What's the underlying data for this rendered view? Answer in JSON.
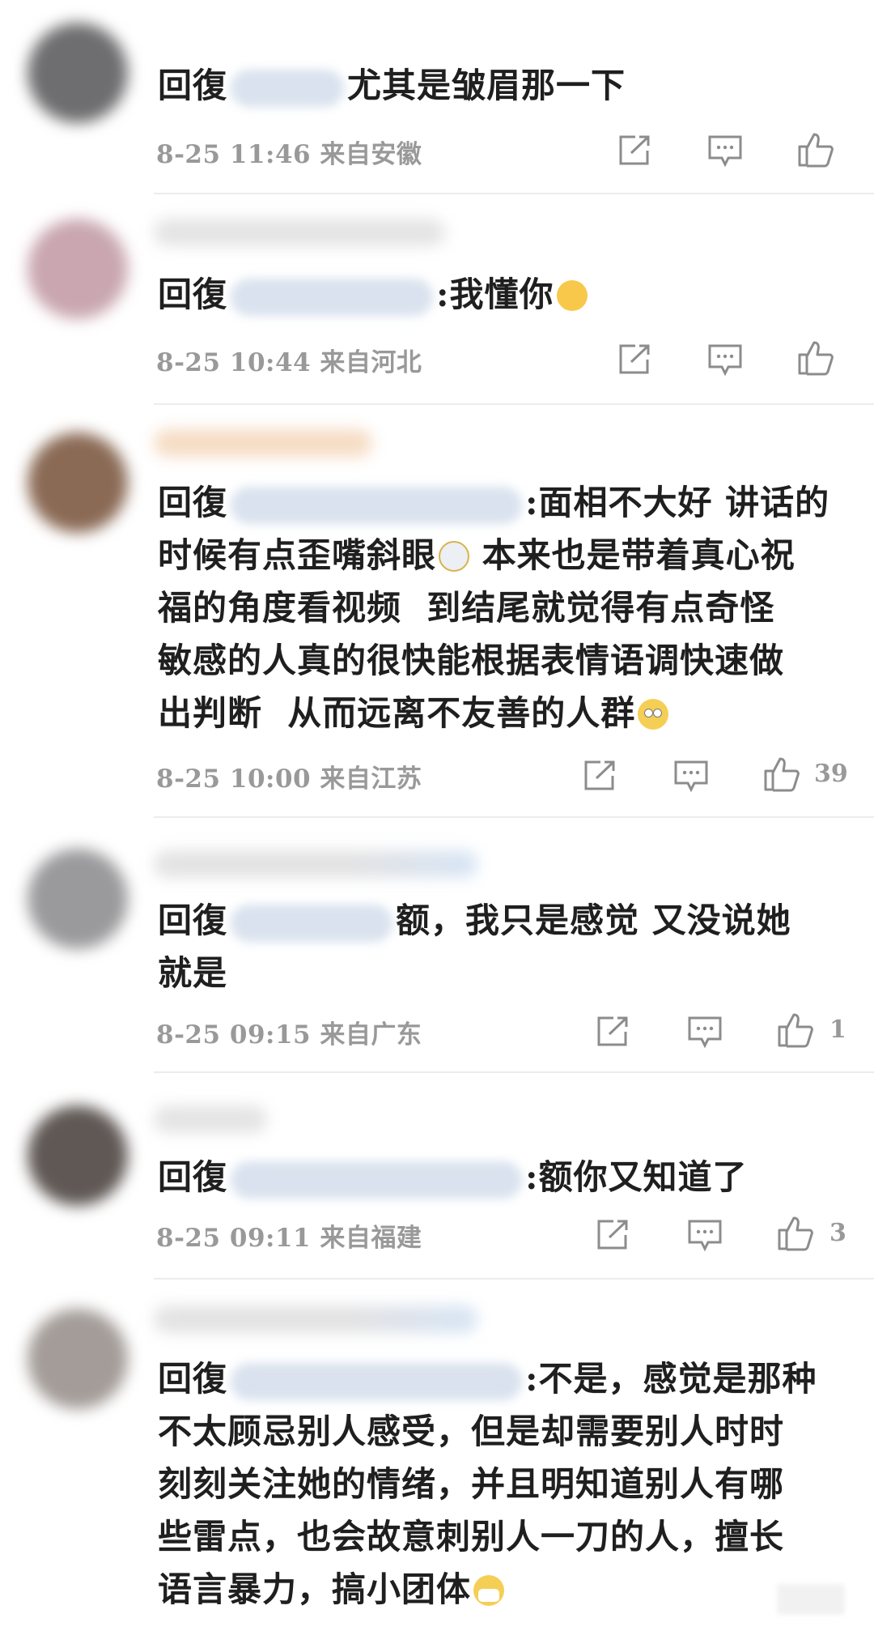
{
  "reply_prefix": "回復",
  "comments": [
    {
      "segments_before_mention": "",
      "text": "尤其是皱眉那一下",
      "emoji": "",
      "date": "8-25 11:46",
      "location": "来自安徽",
      "likes": ""
    },
    {
      "text": ":我懂你",
      "emoji": "hug-emoji",
      "date": "8-25 10:44",
      "location": "来自河北",
      "likes": ""
    },
    {
      "text_line1": ":面相不大好 讲话的",
      "text_line2a": "时候有点歪嘴斜眼",
      "emoji_mid": "dizzy-face-emoji",
      "text_line2b": " 本来也是带着真心祝",
      "text_rest": "福的角度看视频  到结尾就觉得有点奇怪\n敏感的人真的很快能根据表情语调快速做\n出判断  从而远离不友善的人群",
      "emoji": "eye-roll-emoji",
      "date": "8-25 10:00",
      "location": "来自江苏",
      "likes": "39"
    },
    {
      "text_line1": "额，我只是感觉 又没说她",
      "text_rest": "就是",
      "date": "8-25 09:15",
      "location": "来自广东",
      "likes": "1"
    },
    {
      "text": ":额你又知道了",
      "date": "8-25 09:11",
      "location": "来自福建",
      "likes": "3"
    },
    {
      "text_line1": ":不是，感觉是那种",
      "text_rest": "不太顾忌别人感受，但是却需要别人时时\n刻刻关注她的情绪，并且明知道别人有哪\n些雷点，也会故意刺别人一刀的人，擅长\n语言暴力，搞小团体",
      "emoji": "mask-face-emoji"
    }
  ],
  "icons": {
    "share": "share-icon",
    "reply": "reply-icon",
    "like": "thumbs-up-icon"
  },
  "colors": {
    "text": "#1f1f1f",
    "meta": "#999999",
    "divider": "#ececec",
    "mention_blur": "#d9e2ee"
  }
}
